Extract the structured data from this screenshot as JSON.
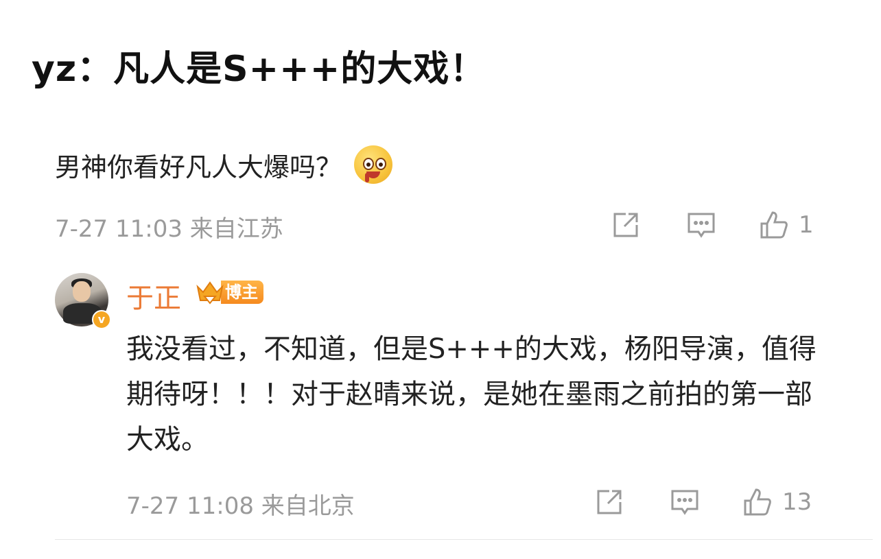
{
  "headline": "yz：凡人是S+++的大戏！",
  "comment": {
    "text": "男神你看好凡人大爆吗？",
    "emoji": "drooling-face-icon",
    "meta": "7-27 11:03 来自江苏",
    "like_count": "1"
  },
  "reply": {
    "username": "于正",
    "badge_label": "博主",
    "text": "我没看过，不知道，但是S+++的大戏，杨阳导演，值得期待呀！！！对于赵晴来说，是她在墨雨之前拍的第一部大戏。",
    "meta": "7-27 11:08 来自北京",
    "like_count": "13"
  },
  "colors": {
    "username": "#eb7a35",
    "meta": "#9a9a9a",
    "badge": "#f58a1f"
  }
}
